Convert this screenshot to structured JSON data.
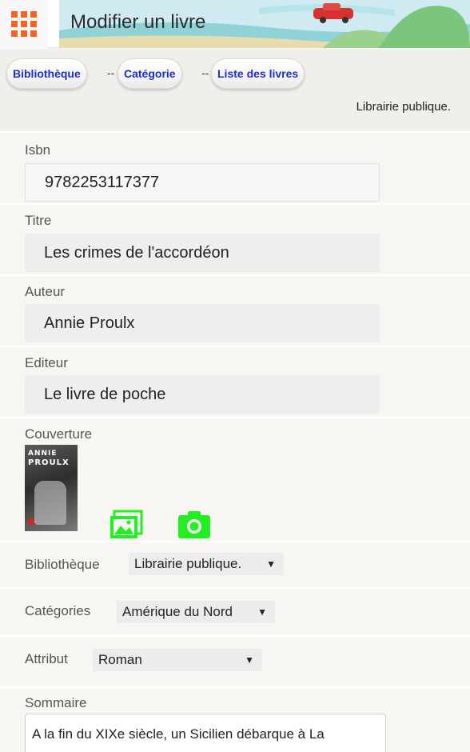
{
  "header": {
    "title": "Modifier un livre",
    "menu_icon": "apps-grid-icon",
    "accent": "#f26522"
  },
  "breadcrumb": {
    "items": [
      {
        "label": "Bibliothèque"
      },
      {
        "label": "Catégorie"
      },
      {
        "label": "Liste des livres"
      }
    ],
    "separator": "--",
    "library_name": "Librairie publique."
  },
  "form": {
    "isbn": {
      "label": "Isbn",
      "value": "9782253117377"
    },
    "titre": {
      "label": "Titre",
      "value": "Les crimes de l'accordéon"
    },
    "auteur": {
      "label": "Auteur",
      "value": "Annie Proulx"
    },
    "editeur": {
      "label": "Editeur",
      "value": "Le livre de poche"
    },
    "couverture": {
      "label": "Couverture",
      "cover_text_1": "ANNIE",
      "cover_text_2": "PROULX",
      "gallery_icon": "image-gallery-icon",
      "camera_icon": "camera-icon",
      "icon_color": "#22ee22"
    },
    "bibliotheque": {
      "label": "Bibliothèque",
      "selected": "Librairie publique."
    },
    "categories": {
      "label": "Catégories",
      "selected": "Amérique du Nord"
    },
    "attribut": {
      "label": "Attribut",
      "selected": "Roman"
    },
    "sommaire": {
      "label": "Sommaire",
      "value": "A la fin du XIXe siècle, un Sicilien débarque à La Nouvelle-Orléans, accompagné de son fils et"
    }
  }
}
